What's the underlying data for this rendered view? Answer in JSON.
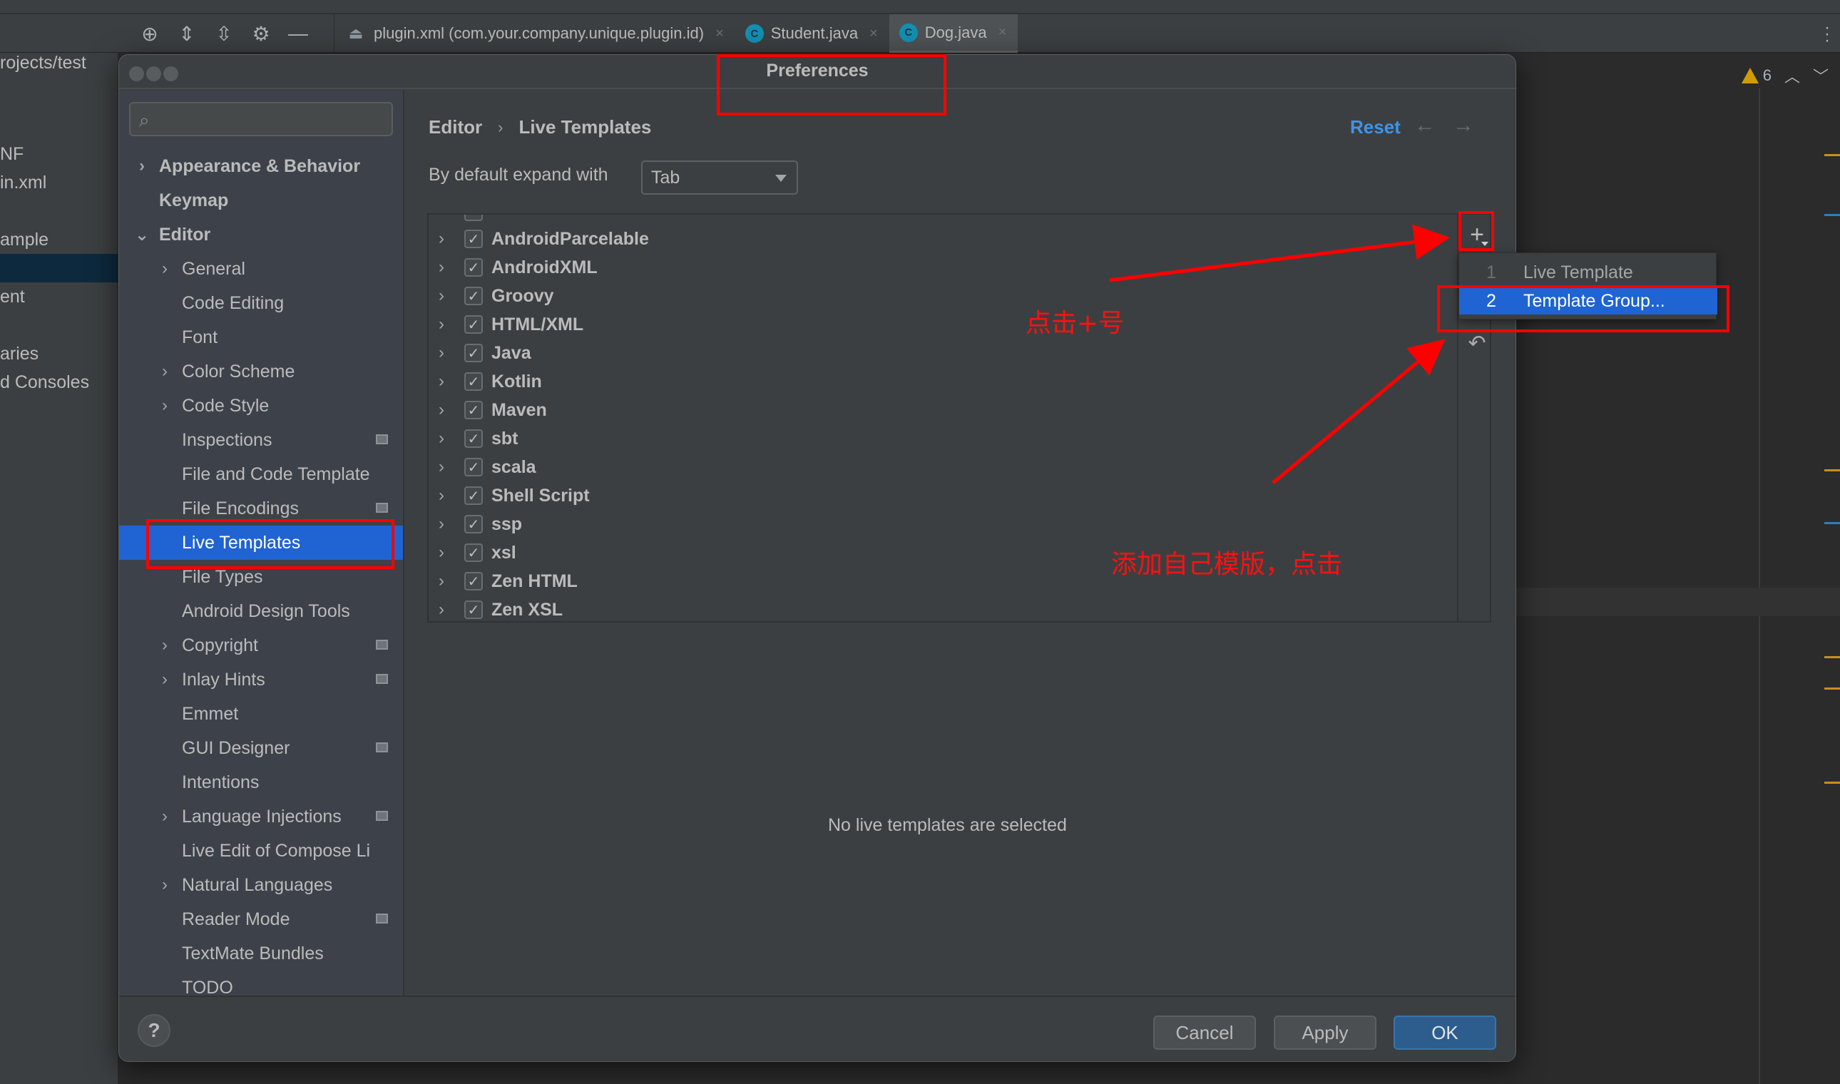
{
  "ide": {
    "tabs": [
      {
        "label": "plugin.xml (com.your.company.unique.plugin.id)",
        "icon": "plugin-icon",
        "active": false
      },
      {
        "label": "Student.java",
        "icon": "class-icon",
        "active": false
      },
      {
        "label": "Dog.java",
        "icon": "class-icon",
        "active": true
      }
    ],
    "tab_close_glyph": "×",
    "class_badge_letter": "C",
    "project_tree": [
      "rojects/test",
      "NF",
      "in.xml",
      "ample",
      "ent",
      "aries",
      "d Consoles"
    ],
    "inspection": {
      "warning_count": "6"
    }
  },
  "dialog": {
    "title": "Preferences",
    "search": {
      "placeholder": "",
      "value": ""
    },
    "sidebar": {
      "items": [
        {
          "label": "Appearance & Behavior",
          "level": 0,
          "bold": true,
          "expandable": true,
          "expanded": false
        },
        {
          "label": "Keymap",
          "level": 0,
          "bold": true,
          "expandable": false
        },
        {
          "label": "Editor",
          "level": 0,
          "bold": true,
          "expandable": true,
          "expanded": true
        },
        {
          "label": "General",
          "level": 1,
          "expandable": true
        },
        {
          "label": "Code Editing",
          "level": 1
        },
        {
          "label": "Font",
          "level": 1
        },
        {
          "label": "Color Scheme",
          "level": 1,
          "expandable": true
        },
        {
          "label": "Code Style",
          "level": 1,
          "expandable": true
        },
        {
          "label": "Inspections",
          "level": 1,
          "project_icon": true
        },
        {
          "label": "File and Code Template",
          "level": 1
        },
        {
          "label": "File Encodings",
          "level": 1,
          "project_icon": true
        },
        {
          "label": "Live Templates",
          "level": 1,
          "selected": true
        },
        {
          "label": "File Types",
          "level": 1
        },
        {
          "label": "Android Design Tools",
          "level": 1
        },
        {
          "label": "Copyright",
          "level": 1,
          "expandable": true,
          "project_icon": true
        },
        {
          "label": "Inlay Hints",
          "level": 1,
          "expandable": true,
          "project_icon": true
        },
        {
          "label": "Emmet",
          "level": 1
        },
        {
          "label": "GUI Designer",
          "level": 1,
          "project_icon": true
        },
        {
          "label": "Intentions",
          "level": 1
        },
        {
          "label": "Language Injections",
          "level": 1,
          "expandable": true,
          "project_icon": true
        },
        {
          "label": "Live Edit of Compose Li",
          "level": 1
        },
        {
          "label": "Natural Languages",
          "level": 1,
          "expandable": true
        },
        {
          "label": "Reader Mode",
          "level": 1,
          "project_icon": true
        },
        {
          "label": "TextMate Bundles",
          "level": 1
        },
        {
          "label": "TODO",
          "level": 1
        }
      ]
    },
    "breadcrumb": {
      "parent": "Editor",
      "separator": "›",
      "current": "Live Templates"
    },
    "reset_label": "Reset",
    "expand_with": {
      "label": "By default expand with",
      "value": "Tab"
    },
    "template_groups": [
      {
        "name": "AndroidParcelable",
        "checked": true
      },
      {
        "name": "AndroidXML",
        "checked": true
      },
      {
        "name": "Groovy",
        "checked": true
      },
      {
        "name": "HTML/XML",
        "checked": true
      },
      {
        "name": "Java",
        "checked": true
      },
      {
        "name": "Kotlin",
        "checked": true
      },
      {
        "name": "Maven",
        "checked": true
      },
      {
        "name": "sbt",
        "checked": true
      },
      {
        "name": "scala",
        "checked": true
      },
      {
        "name": "Shell Script",
        "checked": true
      },
      {
        "name": "ssp",
        "checked": true
      },
      {
        "name": "xsl",
        "checked": true
      },
      {
        "name": "Zen HTML",
        "checked": true
      },
      {
        "name": "Zen XSL",
        "checked": true
      }
    ],
    "add_menu": [
      {
        "num": "1",
        "label": "Live Template",
        "highlighted": false
      },
      {
        "num": "2",
        "label": "Template Group...",
        "highlighted": true
      }
    ],
    "empty_message": "No live templates are selected",
    "buttons": {
      "help": "?",
      "cancel": "Cancel",
      "apply": "Apply",
      "ok": "OK"
    }
  },
  "annotations": {
    "click_plus": "点击+号",
    "add_own_template": "添加自己模版，点击",
    "color": "#ff0000"
  },
  "colors": {
    "selection_blue": "#1f64d2",
    "link_blue": "#3e94e8",
    "warning_yellow": "#d19b08",
    "class_badge": "#148eb1"
  }
}
